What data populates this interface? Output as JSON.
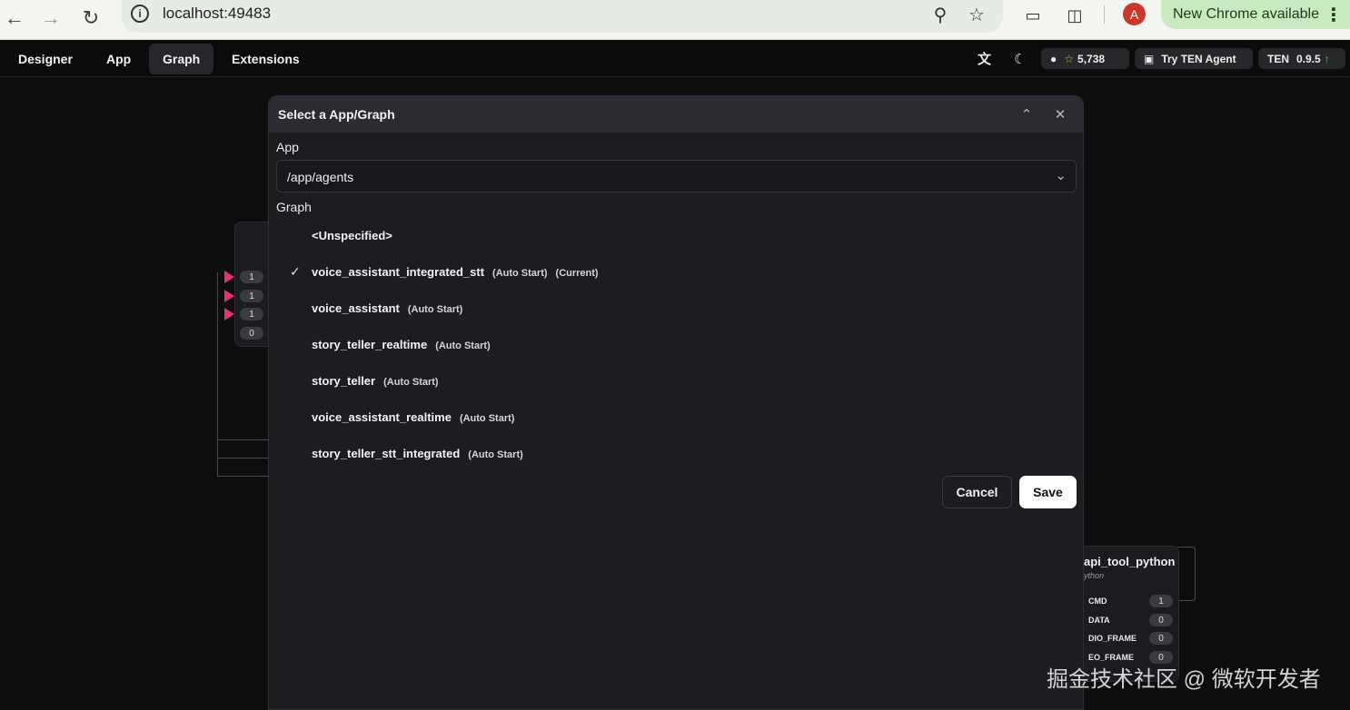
{
  "browser": {
    "url": "localhost:49483",
    "profile_initial": "A",
    "update_notice": "New Chrome available"
  },
  "appbar": {
    "menu": [
      "Designer",
      "App",
      "Graph",
      "Extensions"
    ],
    "active_menu": "Graph",
    "github_stars": "5,738",
    "try_agent": "Try TEN Agent",
    "version_label": "TEN",
    "version": "0.9.5"
  },
  "canvas": {
    "left_node_ports": [
      "1",
      "1",
      "1",
      "0"
    ],
    "right_node": {
      "title": "api_tool_python",
      "subtitle": "ython",
      "ports": [
        {
          "label": "CMD",
          "count": "1"
        },
        {
          "label": "DATA",
          "count": "0"
        },
        {
          "label": "DIO_FRAME",
          "count": "0"
        },
        {
          "label": "EO_FRAME",
          "count": "0"
        }
      ]
    }
  },
  "dialog": {
    "title": "Select a App/Graph",
    "app_label": "App",
    "app_value": "/app/agents",
    "graph_label": "Graph",
    "graphs": [
      {
        "name": "<Unspecified>",
        "tags": [],
        "selected": false
      },
      {
        "name": "voice_assistant_integrated_stt",
        "tags": [
          "(Auto Start)",
          "(Current)"
        ],
        "selected": true
      },
      {
        "name": "voice_assistant",
        "tags": [
          "(Auto Start)"
        ],
        "selected": false
      },
      {
        "name": "story_teller_realtime",
        "tags": [
          "(Auto Start)"
        ],
        "selected": false
      },
      {
        "name": "story_teller",
        "tags": [
          "(Auto Start)"
        ],
        "selected": false
      },
      {
        "name": "voice_assistant_realtime",
        "tags": [
          "(Auto Start)"
        ],
        "selected": false
      },
      {
        "name": "story_teller_stt_integrated",
        "tags": [
          "(Auto Start)"
        ],
        "selected": false
      }
    ],
    "cancel_label": "Cancel",
    "save_label": "Save"
  },
  "watermark": "掘金技术社区 @ 微软开发者"
}
